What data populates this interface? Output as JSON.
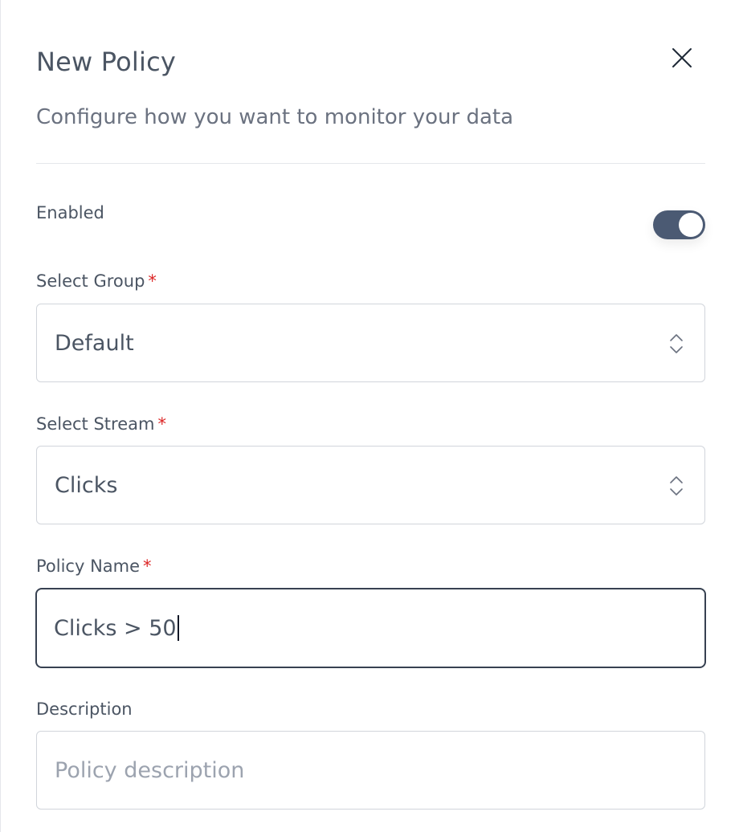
{
  "header": {
    "title": "New Policy",
    "subtitle": "Configure how you want to monitor your data"
  },
  "enabled": {
    "label": "Enabled",
    "value": true
  },
  "group": {
    "label": "Select Group",
    "required_mark": "*",
    "value": "Default"
  },
  "stream": {
    "label": "Select Stream",
    "required_mark": "*",
    "value": "Clicks"
  },
  "policy_name": {
    "label": "Policy Name",
    "required_mark": "*",
    "value": "Clicks > 50"
  },
  "description": {
    "label": "Description",
    "placeholder": "Policy description",
    "value": ""
  },
  "colors": {
    "toggle_on": "#4b5a73",
    "required": "#dc2626",
    "focus_border": "#374151"
  },
  "icons": {
    "close": "close-icon",
    "select": "chevron-up-down-icon"
  }
}
